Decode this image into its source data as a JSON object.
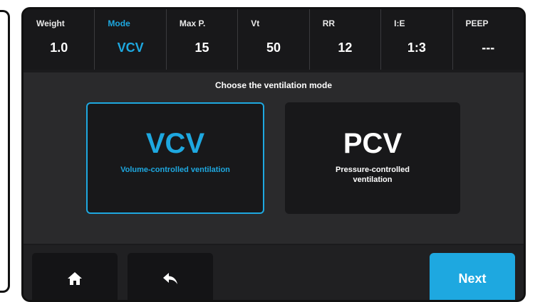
{
  "header": {
    "params": [
      {
        "label": "Weight",
        "value": "1.0"
      },
      {
        "label": "Mode",
        "value": "VCV"
      },
      {
        "label": "Max P.",
        "value": "15"
      },
      {
        "label": "Vt",
        "value": "50"
      },
      {
        "label": "RR",
        "value": "12"
      },
      {
        "label": "I:E",
        "value": "1:3"
      },
      {
        "label": "PEEP",
        "value": "---"
      }
    ],
    "active_index": 1
  },
  "main": {
    "prompt": "Choose the ventilation mode",
    "modes": [
      {
        "abbr": "VCV",
        "description": "Volume-controlled ventilation",
        "selected": true
      },
      {
        "abbr": "PCV",
        "description": "Pressure-controlled ventilation",
        "selected": false
      }
    ]
  },
  "footer": {
    "home_icon": "home-icon",
    "back_icon": "back-arrow-icon",
    "next_label": "Next"
  },
  "colors": {
    "accent": "#1ea8e0",
    "panel_dark": "#18181a",
    "background": "#2a2a2c"
  }
}
